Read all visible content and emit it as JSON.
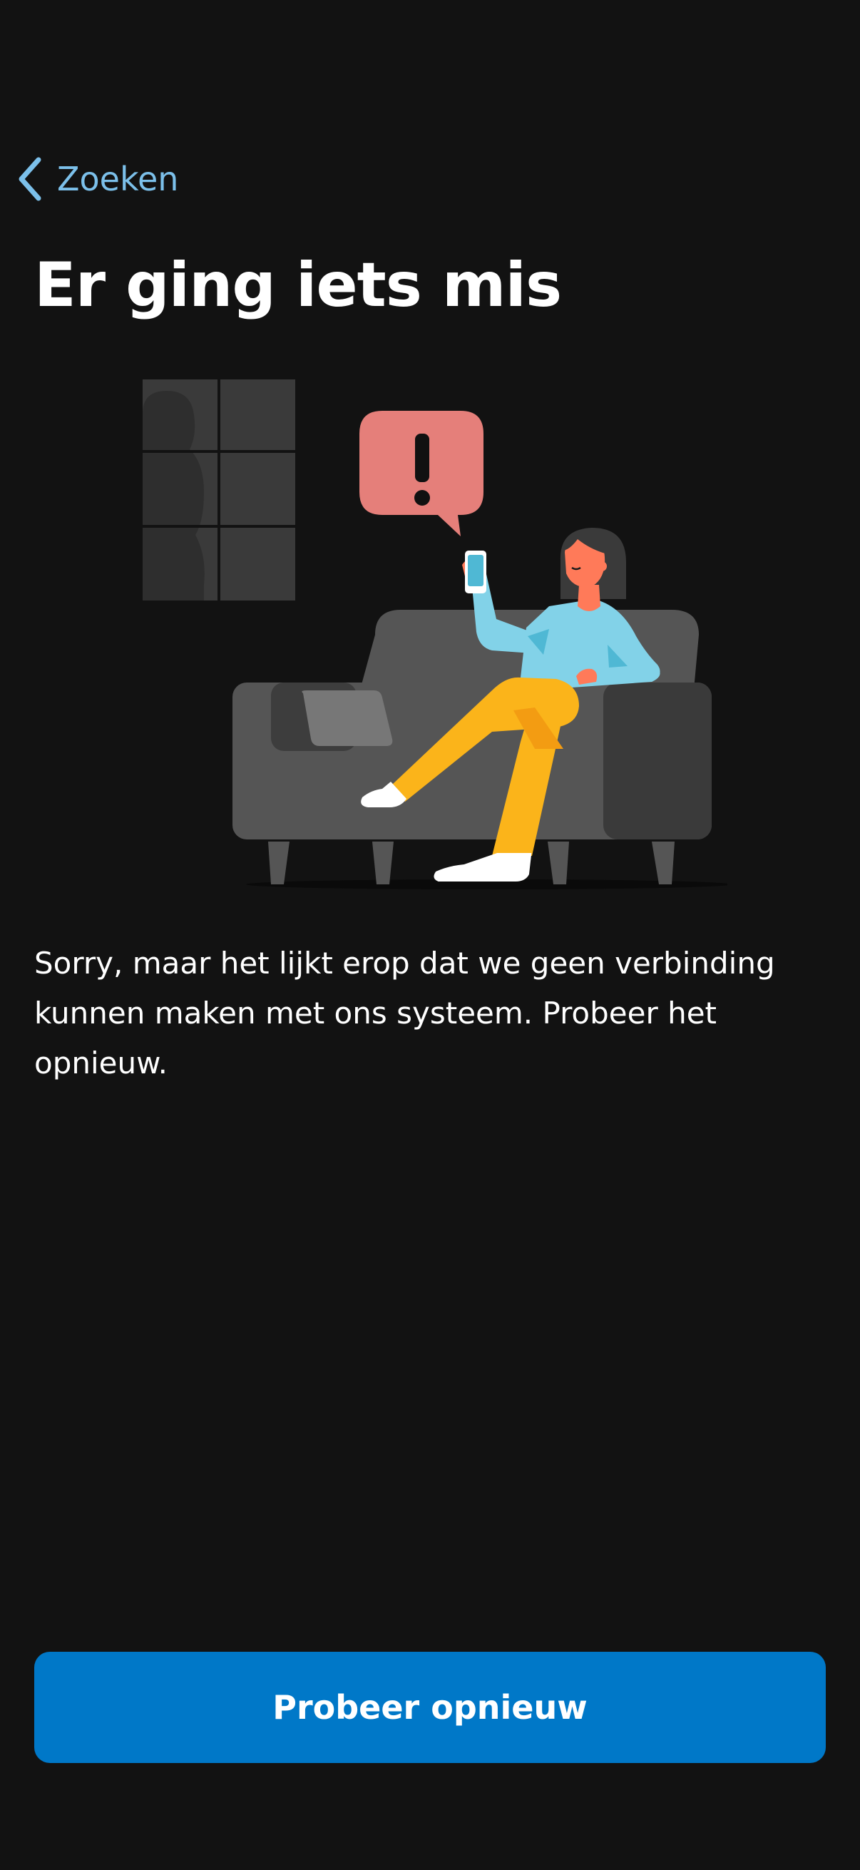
{
  "nav": {
    "back_label": "Zoeken",
    "back_icon": "chevron-left-icon"
  },
  "header": {
    "title": "Er ging iets mis"
  },
  "illustration": {
    "subject": "person-on-sofa-with-phone-error",
    "alert_icon": "exclamation-icon"
  },
  "main": {
    "message": "Sorry, maar het lijkt erop dat we geen verbinding kunnen maken met ons systeem. Probeer het opnieuw."
  },
  "actions": {
    "retry_label": "Probeer opnieuw"
  },
  "colors": {
    "background": "#121212",
    "accent_link": "#7cc0ea",
    "primary_button": "#0078c8",
    "alert_bubble": "#e57f7a",
    "sofa": "#555555",
    "shirt": "#82d2e8",
    "pants": "#fbb41a"
  }
}
